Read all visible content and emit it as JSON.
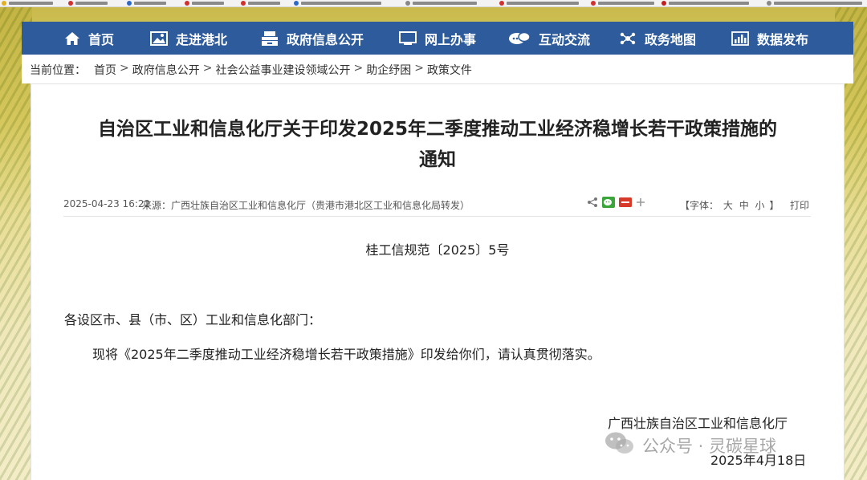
{
  "nav": {
    "items": [
      {
        "label": "首页",
        "icon": "home-icon"
      },
      {
        "label": "走进港北",
        "icon": "picture-icon"
      },
      {
        "label": "政府信息公开",
        "icon": "document-tray-icon"
      },
      {
        "label": "网上办事",
        "icon": "monitor-icon"
      },
      {
        "label": "互动交流",
        "icon": "chat-icon"
      },
      {
        "label": "政务地图",
        "icon": "map-network-icon"
      },
      {
        "label": "数据发布",
        "icon": "bar-chart-icon"
      }
    ],
    "color": "#2d5b9c"
  },
  "breadcrumb": {
    "label": "当前位置：",
    "items": [
      "首页",
      "政府信息公开",
      "社会公益事业建设领域公开",
      "助企纾困",
      "政策文件"
    ]
  },
  "article": {
    "title_line1": "自治区工业和信息化厅关于印发2025年二季度推动工业经济稳增长若干政策措施的",
    "title_line2": "通知",
    "date": "2025-04-23 16:22",
    "source": "来源：广西壮族自治区工业和信息化厅（贵港市港北区工业和信息化局转发）",
    "font_label": "【字体：",
    "font_large": "大",
    "font_medium": "中",
    "font_small": "小",
    "font_close": "】",
    "print": "打印",
    "doc_number": "桂工信规范〔2025〕5号",
    "addressee": "各设区市、县（市、区）工业和信息化部门：",
    "body": "现将《2025年二季度推动工业经济稳增长若干政策措施》印发给你们，请认真贯彻落实。",
    "signer": "广西壮族自治区工业和信息化厅",
    "sign_date": "2025年4月18日"
  },
  "watermark": {
    "text": "公众号 · 灵碳星球"
  }
}
